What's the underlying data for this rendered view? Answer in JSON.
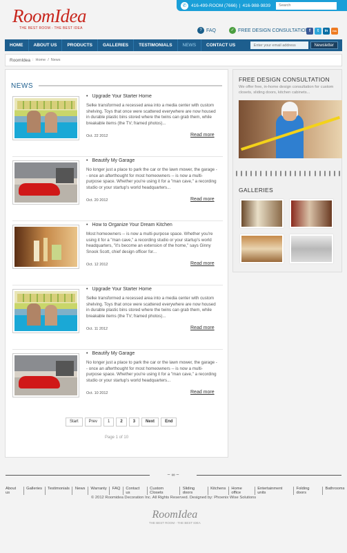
{
  "brand": {
    "name": "RoomIdea",
    "tagline": "THE BEST ROOM - THE BEST IDEA"
  },
  "topbar": {
    "phone1": "416-499-ROOM (7666)",
    "phone2": "416-988-9839",
    "search_placeholder": "Search"
  },
  "links": {
    "faq": "FAQ",
    "consult": "FREE DESIGN CONSULTATION"
  },
  "social": [
    "f",
    "t",
    "in",
    "rss"
  ],
  "nav": {
    "items": [
      "HOME",
      "ABOUT US",
      "PRODUCTS",
      "GALLERIES",
      "TESTIMONIALS",
      "NEWS",
      "CONTACT US"
    ],
    "active": "NEWS",
    "email_placeholder": "Enter your email address",
    "newsletter": "Newsletter"
  },
  "breadcrumb": {
    "site": "RoomIdea",
    "sep": ":",
    "home": "Home",
    "sep2": "/",
    "current": "News"
  },
  "main": {
    "title": "NEWS"
  },
  "articles": [
    {
      "title": "Upgrade Your Starter Home",
      "body": "Selke transformed a recessed area into a media center with custom shelving. Toys that once were scattered everywhere are now housed in durable plastic bins stored where the twins can grab them, while breakable items (the TV; framed photos)...",
      "date": "Oct. 22 2012",
      "more": "Read more"
    },
    {
      "title": "Beautify My Garage",
      "body": "No longer just a place to park the car or the lawn mower, the garage -- once an afterthought for most homeowners -- is now a multi-purpose space. Whether you're using it for a \"man cave,\" a recording studio or your startup's world headquarters...",
      "date": "Oct. 20 2012",
      "more": "Read more"
    },
    {
      "title": "How to Organize Your Dream Kitchen",
      "body": "Most homeowners -- is now a multi-purpose space. Whether you're using it for a \"man cave,\" a recording studio or your startup's world headquarters, \"it's become an extension of the home,\" says Ginny Snook Scott, chief design officer for...",
      "date": "Oct. 12 2012",
      "more": "Read more"
    },
    {
      "title": "Upgrade Your Starter Home",
      "body": "Selke transformed a recessed area into a media center with custom shelving. Toys that once were scattered everywhere are now housed in durable plastic bins stored where the twins can grab them, while breakable items (the TV; framed photos)...",
      "date": "Oct. 11 2012",
      "more": "Read more"
    },
    {
      "title": "Beautify My Garage",
      "body": "No longer just a place to park the car or the lawn mower, the garage -- once an afterthought for most homeowners -- is now a multi-purpose space. Whether you're using it for a \"man cave,\" a recording studio or your startup's world headquarters...",
      "date": "Oct. 10 2012",
      "more": "Read more"
    }
  ],
  "pager": {
    "buttons": [
      "Start",
      "Prev",
      "1",
      "2",
      "3",
      "Next",
      "End"
    ],
    "info": "Page 1 of 10"
  },
  "sidebar": {
    "consult_title": "FREE DESIGN CONSULTATION",
    "consult_text": "We offer free, in-home design consultation for custom closets, sliding doors, kitchen cabinets...",
    "galleries_title": "GALLERIES"
  },
  "footer": {
    "links": [
      "About us",
      "Galleries",
      "Testimonials",
      "News",
      "Warranty",
      "FAQ",
      "Contact us",
      "Custom Closets",
      "Sliding doors",
      "Kitchens",
      "Home office",
      "Entertainment units",
      "Folding doors",
      "Bathrooms"
    ],
    "copyright": "© 2012 Roomidea Decoration Inc. All Rights Reserved.   Designed by: Phoenix Wise Solutions"
  },
  "colors": {
    "accent": "#1a9fd8",
    "nav": "#1d5e8e",
    "brand": "#c8261d"
  }
}
